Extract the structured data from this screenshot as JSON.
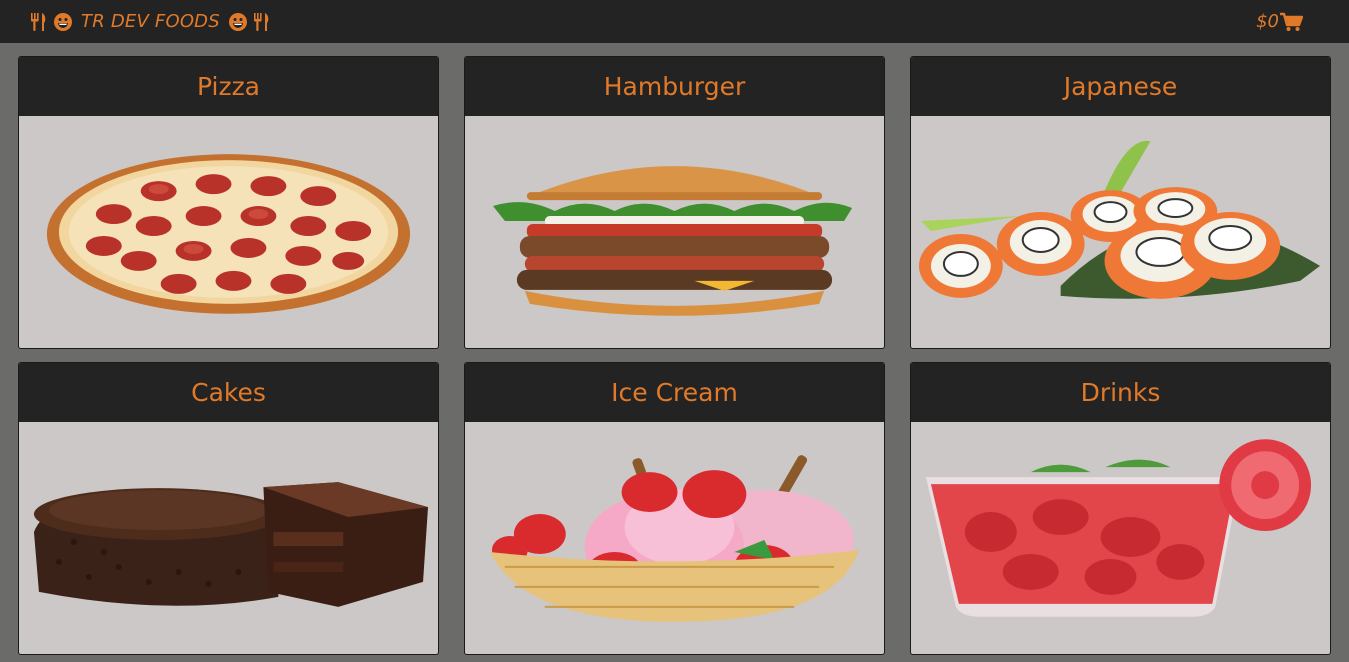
{
  "navbar": {
    "brand_text": "TR DEV FOODS",
    "cart_total": "$0",
    "accent_color": "#e07a2a",
    "icons": [
      "utensils-icon",
      "grin-icon",
      "cart-icon"
    ]
  },
  "categories": [
    {
      "title": "Pizza",
      "image": "pizza-image"
    },
    {
      "title": "Hamburger",
      "image": "hamburger-image"
    },
    {
      "title": "Japanese",
      "image": "sushi-image"
    },
    {
      "title": "Cakes",
      "image": "cake-image"
    },
    {
      "title": "Ice Cream",
      "image": "ice-cream-image"
    },
    {
      "title": "Drinks",
      "image": "drink-image"
    }
  ]
}
